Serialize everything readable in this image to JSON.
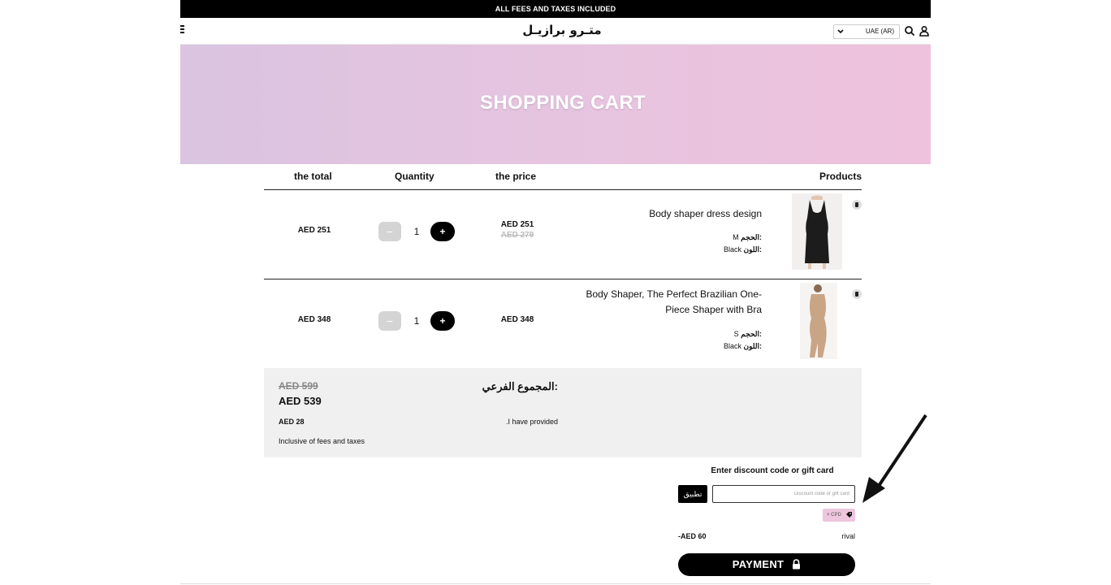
{
  "topbar": {
    "text": "ALL FEES AND TAXES INCLUDED"
  },
  "header": {
    "logo": "متـرو برازيـل",
    "country_select": "UAE (AR)",
    "icons": [
      "menu-icon",
      "search-icon",
      "account-icon",
      "chevron-down-icon"
    ]
  },
  "hero": {
    "title": "SHOPPING CART"
  },
  "cart": {
    "columns": {
      "total": "the total",
      "quantity": "Quantity",
      "price": "the price",
      "products": "Products"
    },
    "items": [
      {
        "name": "Body shaper dress design",
        "size_label": "الحجم:",
        "size_value": "M",
        "color_label": "اللون:",
        "color_value": "Black",
        "price": "AED 251",
        "old_price": "AED 279",
        "quantity": "1",
        "total": "AED 251",
        "minus": "−",
        "plus": "+"
      },
      {
        "name": "Body Shaper, The Perfect Brazilian One-Piece Shaper with Bra",
        "size_label": "الحجم:",
        "size_value": "S",
        "color_label": "اللون:",
        "color_value": "Black",
        "price": "AED 348",
        "quantity": "1",
        "total": "AED 348",
        "minus": "−",
        "plus": "+"
      }
    ]
  },
  "summary": {
    "subtotal_label": "المجموع الفرعي:",
    "subtotal_old": "AED 599",
    "subtotal_new": "AED 539",
    "saved_label": ".I have provided",
    "saved_value": "AED 28",
    "inclusive_note": "Inclusive of fees and taxes"
  },
  "discount": {
    "title": "Enter discount code or gift card",
    "apply_label": "تطبيق",
    "placeholder": "Discount code or gift card",
    "applied_code": "× CPD",
    "rival_label": "rival",
    "rival_value": "-AED 60"
  },
  "checkout": {
    "pay_label": "PAYMENT"
  },
  "colors": {
    "hero_start": "#dac4e0",
    "hero_end": "#eec2dc",
    "accent": "#000000",
    "tag": "#eec6de"
  }
}
